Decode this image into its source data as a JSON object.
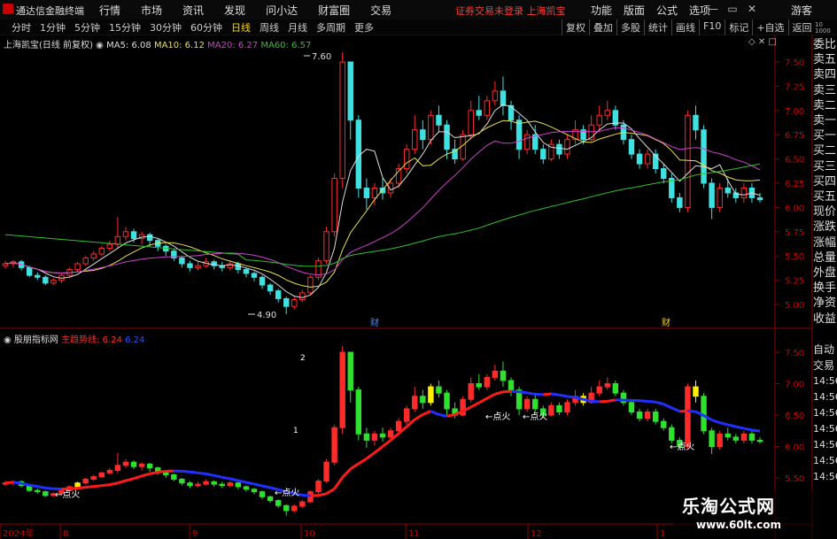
{
  "window": {
    "app_title": "通达信金融终端",
    "menu": [
      "行情",
      "市场",
      "资讯",
      "发现",
      "问小达",
      "财富圈",
      "交易"
    ],
    "warning": "证券交易未登录  上海凯宝",
    "right_menu": [
      "功能",
      "版面",
      "公式",
      "选项"
    ],
    "guest_label": "游客"
  },
  "toolbar": {
    "periods": [
      "分时",
      "1分钟",
      "5分钟",
      "15分钟",
      "30分钟",
      "60分钟",
      "日线",
      "周线",
      "月线",
      "多周期",
      "更多"
    ],
    "active_period": "日线",
    "tools": [
      "复权",
      "叠加",
      "多股",
      "统计",
      "画线",
      "F10",
      "标记",
      "+自选",
      "返回"
    ]
  },
  "main_chart": {
    "stock_label": "上海凯宝(日线 前复权)",
    "ma_labels": [
      {
        "text": "MA5: 6.08",
        "color": "#dddddd"
      },
      {
        "text": "MA10: 6.12",
        "color": "#e8e04a"
      },
      {
        "text": "MA20: 6.27",
        "color": "#d040d0"
      },
      {
        "text": "MA60: 6.57",
        "color": "#30c030"
      }
    ],
    "high_label": "7.60",
    "low_label": "4.90",
    "event_marks": [
      "财",
      "财"
    ],
    "y_ticks": [
      "7.50",
      "7.25",
      "7.00",
      "6.75",
      "6.50",
      "6.25",
      "6.00",
      "5.75",
      "5.50",
      "5.25",
      "5.00"
    ]
  },
  "sub_chart": {
    "indicator_name": "股朋指标网",
    "line_label": "主趋势线: 6.24",
    "value2": "6.24",
    "signals": [
      "←点火",
      "←点火",
      "←点火",
      "←点火",
      "←点火"
    ],
    "bar_tags": [
      "2",
      "1"
    ],
    "y_ticks": [
      "7.50",
      "7.00",
      "6.50",
      "6.00",
      "5.50"
    ]
  },
  "x_axis": [
    "2024年",
    "8",
    "9",
    "10",
    "11",
    "12",
    "1"
  ],
  "right_panel": {
    "labels": [
      "委比",
      "卖五",
      "卖四",
      "卖三",
      "卖二",
      "卖一",
      "买一",
      "买二",
      "买三",
      "买四",
      "买五",
      "现价",
      "涨跌",
      "涨幅",
      "总量",
      "外盘",
      "换手",
      "净资",
      "收益"
    ],
    "bottom_labels": [
      "自动",
      "交易",
      "14:56",
      "14:56",
      "14:56",
      "14:56",
      "14:56",
      "14:56",
      "14:56"
    ],
    "head_nums": [
      "10",
      "1000"
    ]
  },
  "watermark": {
    "line1": "乐淘公式网",
    "line2": "www.60lt.com"
  },
  "colors": {
    "up": "#ff2a2a",
    "down": "#3fe0e0",
    "sub_down": "#2fe02f",
    "signal": "#ffee00",
    "trend_up": "#ff1a1a",
    "trend_down": "#2030ff"
  },
  "chart_data": {
    "type": "candlestick",
    "ylim": [
      4.85,
      7.75
    ],
    "highlight": {
      "high": 7.6,
      "low": 4.9
    },
    "candles": [
      [
        5.4,
        5.42,
        5.45,
        5.37
      ],
      [
        5.42,
        5.44,
        5.46,
        5.38
      ],
      [
        5.44,
        5.38,
        5.46,
        5.35
      ],
      [
        5.38,
        5.3,
        5.4,
        5.28
      ],
      [
        5.3,
        5.28,
        5.33,
        5.25
      ],
      [
        5.28,
        5.22,
        5.3,
        5.2
      ],
      [
        5.22,
        5.25,
        5.27,
        5.2
      ],
      [
        5.25,
        5.3,
        5.33,
        5.22
      ],
      [
        5.3,
        5.36,
        5.38,
        5.28
      ],
      [
        5.36,
        5.42,
        5.44,
        5.33
      ],
      [
        5.42,
        5.48,
        5.5,
        5.4
      ],
      [
        5.48,
        5.52,
        5.55,
        5.45
      ],
      [
        5.52,
        5.58,
        5.6,
        5.5
      ],
      [
        5.58,
        5.62,
        5.66,
        5.55
      ],
      [
        5.62,
        5.7,
        5.9,
        5.58
      ],
      [
        5.7,
        5.75,
        5.8,
        5.66
      ],
      [
        5.75,
        5.68,
        5.78,
        5.64
      ],
      [
        5.68,
        5.72,
        5.75,
        5.62
      ],
      [
        5.72,
        5.66,
        5.74,
        5.6
      ],
      [
        5.66,
        5.6,
        5.68,
        5.55
      ],
      [
        5.6,
        5.55,
        5.62,
        5.5
      ],
      [
        5.55,
        5.48,
        5.57,
        5.45
      ],
      [
        5.48,
        5.42,
        5.5,
        5.38
      ],
      [
        5.42,
        5.38,
        5.45,
        5.34
      ],
      [
        5.38,
        5.4,
        5.44,
        5.35
      ],
      [
        5.4,
        5.44,
        5.48,
        5.38
      ],
      [
        5.44,
        5.4,
        5.46,
        5.36
      ],
      [
        5.4,
        5.38,
        5.44,
        5.34
      ],
      [
        5.38,
        5.42,
        5.45,
        5.35
      ],
      [
        5.42,
        5.36,
        5.44,
        5.32
      ],
      [
        5.36,
        5.32,
        5.38,
        5.28
      ],
      [
        5.32,
        5.28,
        5.34,
        5.24
      ],
      [
        5.28,
        5.2,
        5.3,
        5.16
      ],
      [
        5.2,
        5.14,
        5.22,
        5.1
      ],
      [
        5.14,
        5.06,
        5.16,
        5.02
      ],
      [
        5.06,
        4.98,
        5.08,
        4.9
      ],
      [
        4.98,
        5.05,
        5.08,
        4.95
      ],
      [
        5.05,
        5.12,
        5.15,
        5.02
      ],
      [
        5.12,
        5.28,
        5.3,
        5.1
      ],
      [
        5.28,
        5.45,
        5.48,
        5.25
      ],
      [
        5.45,
        5.75,
        5.8,
        5.42
      ],
      [
        5.75,
        6.3,
        6.35,
        5.7
      ],
      [
        6.3,
        7.5,
        7.6,
        6.2
      ],
      [
        7.5,
        6.9,
        7.2,
        6.7
      ],
      [
        6.9,
        6.2,
        6.95,
        6.1
      ],
      [
        6.2,
        6.1,
        6.3,
        5.98
      ],
      [
        6.1,
        6.2,
        6.25,
        6.02
      ],
      [
        6.2,
        6.15,
        6.3,
        6.08
      ],
      [
        6.15,
        6.25,
        6.3,
        6.1
      ],
      [
        6.25,
        6.4,
        6.45,
        6.2
      ],
      [
        6.4,
        6.6,
        6.65,
        6.35
      ],
      [
        6.6,
        6.8,
        6.95,
        6.55
      ],
      [
        6.8,
        6.7,
        6.9,
        6.6
      ],
      [
        6.7,
        6.95,
        7.0,
        6.65
      ],
      [
        6.95,
        6.85,
        7.05,
        6.78
      ],
      [
        6.85,
        6.6,
        6.9,
        6.5
      ],
      [
        6.6,
        6.5,
        6.7,
        6.45
      ],
      [
        6.5,
        6.75,
        6.8,
        6.48
      ],
      [
        6.75,
        7.0,
        7.1,
        6.7
      ],
      [
        7.0,
        6.95,
        7.15,
        6.9
      ],
      [
        6.95,
        7.1,
        7.15,
        6.9
      ],
      [
        7.1,
        7.2,
        7.3,
        7.05
      ],
      [
        7.2,
        7.05,
        7.35,
        6.95
      ],
      [
        7.05,
        6.9,
        7.1,
        6.8
      ],
      [
        6.9,
        6.6,
        6.95,
        6.5
      ],
      [
        6.6,
        6.75,
        6.8,
        6.55
      ],
      [
        6.75,
        6.6,
        6.85,
        6.55
      ],
      [
        6.6,
        6.5,
        6.65,
        6.45
      ],
      [
        6.5,
        6.65,
        6.7,
        6.48
      ],
      [
        6.65,
        6.55,
        6.7,
        6.5
      ],
      [
        6.55,
        6.7,
        6.75,
        6.5
      ],
      [
        6.7,
        6.8,
        6.9,
        6.65
      ],
      [
        6.8,
        6.7,
        6.85,
        6.65
      ],
      [
        6.7,
        6.85,
        6.95,
        6.68
      ],
      [
        6.85,
        6.95,
        7.05,
        6.8
      ],
      [
        6.95,
        7.0,
        7.1,
        6.9
      ],
      [
        7.0,
        6.85,
        7.05,
        6.8
      ],
      [
        6.85,
        6.7,
        6.9,
        6.65
      ],
      [
        6.7,
        6.55,
        6.75,
        6.5
      ],
      [
        6.55,
        6.45,
        6.6,
        6.4
      ],
      [
        6.45,
        6.55,
        6.6,
        6.4
      ],
      [
        6.55,
        6.4,
        6.6,
        6.35
      ],
      [
        6.4,
        6.3,
        6.45,
        6.25
      ],
      [
        6.3,
        6.1,
        6.35,
        6.05
      ],
      [
        6.1,
        6.0,
        6.15,
        5.95
      ],
      [
        6.0,
        6.95,
        7.0,
        5.95
      ],
      [
        6.95,
        6.8,
        7.05,
        6.7
      ],
      [
        6.8,
        6.25,
        6.85,
        6.2
      ],
      [
        6.25,
        6.0,
        6.3,
        5.88
      ],
      [
        6.0,
        6.2,
        6.25,
        5.95
      ],
      [
        6.2,
        6.15,
        6.3,
        6.1
      ],
      [
        6.15,
        6.1,
        6.2,
        6.05
      ],
      [
        6.1,
        6.2,
        6.25,
        6.05
      ],
      [
        6.2,
        6.1,
        6.25,
        6.05
      ],
      [
        6.1,
        6.08,
        6.15,
        6.05
      ]
    ]
  }
}
